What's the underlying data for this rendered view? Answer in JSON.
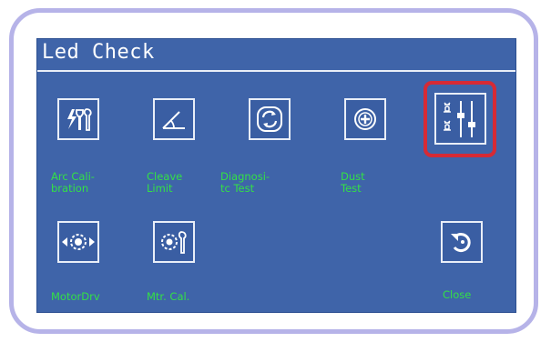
{
  "screen": {
    "title": "Led Check"
  },
  "tiles": [
    {
      "name": "arc-calibration",
      "icon": "arc-calibration-icon",
      "label": "Arc Cali-\nbration"
    },
    {
      "name": "cleave-limit",
      "icon": "cleave-angle-icon",
      "label": "Cleave\nLimit"
    },
    {
      "name": "diagnostic-test",
      "icon": "refresh-icon",
      "label": "Diagnosi-\ntc Test"
    },
    {
      "name": "dust-test",
      "icon": "magnifier-plus-icon",
      "label": "Dust\nTest"
    },
    {
      "name": "led-check",
      "icon": "led-sliders-icon",
      "label": ""
    },
    {
      "name": "motor-drive",
      "icon": "motor-gear-arrows-icon",
      "label": "MotorDrv"
    },
    {
      "name": "motor-calibration",
      "icon": "gear-wrench-icon",
      "label": "Mtr. Cal."
    },
    {
      "name": "close",
      "icon": "undo-icon",
      "label": "Close"
    }
  ],
  "colors": {
    "screen_bg": "#3f64a9",
    "label_green": "#33e046",
    "highlight_red": "#d62a35",
    "bezel": "#b6b3e8"
  }
}
